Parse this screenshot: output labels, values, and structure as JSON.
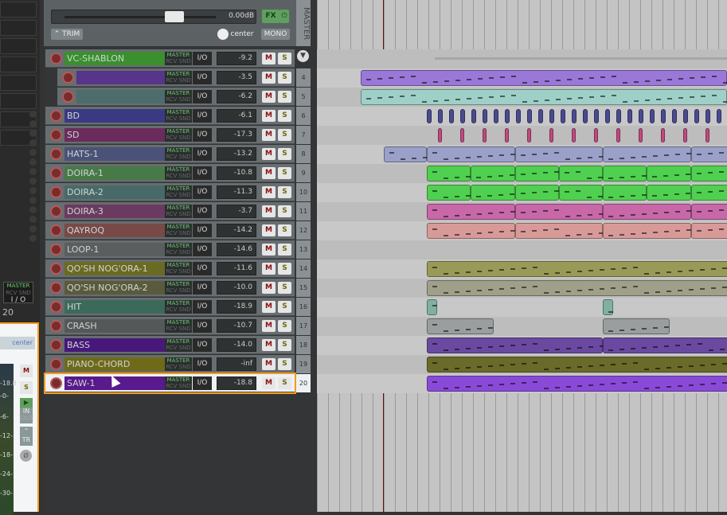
{
  "mixer": {
    "route": {
      "top": "MASTER",
      "bottom": "RCV SND",
      "io": "I / O"
    },
    "track_number": "20",
    "pan": "center",
    "meter_value": "-18.8",
    "meter_ticks": [
      "-0-",
      "-6-",
      "-12-",
      "-18-",
      "-24-",
      "-30-"
    ],
    "mute": "M",
    "solo": "S",
    "in": "IN",
    "out": "OUT",
    "trim": "TR"
  },
  "master": {
    "label": "MASTER",
    "volume": "0.00dB",
    "fx": "FX",
    "trim": "TRIM",
    "pan": "center",
    "mono": "MONO"
  },
  "route_labels": {
    "top": "MASTER",
    "bottom": "RCV SND",
    "io": "I/O",
    "mute": "M",
    "solo": "S"
  },
  "tracks": [
    {
      "number": "",
      "name": "VC-SHABLON",
      "color": "#3a8f2f",
      "volume": "-9.2"
    },
    {
      "number": "4",
      "name": "",
      "color": "#56358a",
      "volume": "-3.5"
    },
    {
      "number": "5",
      "name": "",
      "color": "#4d6c6c",
      "volume": "-6.2"
    },
    {
      "number": "6",
      "name": "BD",
      "color": "#3a3a82",
      "volume": "-6.1"
    },
    {
      "number": "7",
      "name": "SD",
      "color": "#6a2c5c",
      "volume": "-17.3"
    },
    {
      "number": "8",
      "name": "HATS-1",
      "color": "#4a5278",
      "volume": "-13.2"
    },
    {
      "number": "9",
      "name": "DOIRA-1",
      "color": "#477a47",
      "volume": "-10.8"
    },
    {
      "number": "10",
      "name": "DOIRA-2",
      "color": "#476a68",
      "volume": "-11.3"
    },
    {
      "number": "11",
      "name": "DOIRA-3",
      "color": "#6a3a60",
      "volume": "-3.7"
    },
    {
      "number": "12",
      "name": "QAYROQ",
      "color": "#774a48",
      "volume": "-14.2"
    },
    {
      "number": "13",
      "name": "LOOP-1",
      "color": "#5a5e5e",
      "volume": "-14.6"
    },
    {
      "number": "14",
      "name": "QO'SH NOG'ORA-1",
      "color": "#6a6a22",
      "volume": "-11.6"
    },
    {
      "number": "15",
      "name": "QO'SH NOG'ORA-2",
      "color": "#5a5a3c",
      "volume": "-10.0"
    },
    {
      "number": "16",
      "name": "HIT",
      "color": "#3c6a5a",
      "volume": "-18.9"
    },
    {
      "number": "17",
      "name": "CRASH",
      "color": "#555858",
      "volume": "-10.7"
    },
    {
      "number": "18",
      "name": "BASS",
      "color": "#47187a",
      "volume": "-14.0"
    },
    {
      "number": "19",
      "name": "PIANO-CHORD",
      "color": "#6e6a1a",
      "volume": "-inf"
    },
    {
      "number": "20",
      "name": "SAW-1",
      "color": "#581a8c",
      "volume": "-18.8",
      "selected": true
    }
  ],
  "item_colors": [
    "#a0a0a0",
    "#9a78d8",
    "#9fd0c8",
    "#4a4a90",
    "#c04a80",
    "#9aa0c8",
    "#50d050",
    "#50d050",
    "#c868a8",
    "#d89a98",
    "",
    "#9a9a58",
    "#a0a08a",
    "#80b0a0",
    "#9a9e9e",
    "#6a4aa0",
    "#6a6a2a",
    "#8a4ad8"
  ]
}
